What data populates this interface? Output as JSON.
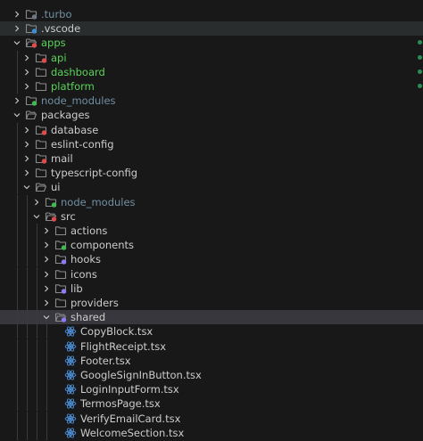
{
  "colors": {
    "background": "#181818",
    "row_highlight": "#2a2d2e",
    "row_selected": "#37373d",
    "text_default": "#cccccc",
    "text_ignored": "#6f8fa3",
    "text_added": "#5ad25a",
    "folder_stroke": "#8a8a8a",
    "tsx_icon": "#4d8fd8",
    "chevron": "#c5c5c5",
    "guide": "#3b3b3b",
    "dot_added": "#2e8b57"
  },
  "explorer": {
    "items": [
      {
        "label": ".turbo",
        "depth": 0,
        "type": "folder",
        "expanded": false,
        "color": "ignored",
        "badge": "#6e7681"
      },
      {
        "label": ".vscode",
        "depth": 0,
        "type": "folder",
        "expanded": false,
        "color": "default",
        "badge": "#3c8fd6",
        "highlight": true
      },
      {
        "label": "apps",
        "depth": 0,
        "type": "folder",
        "expanded": true,
        "color": "added",
        "badge": "#e04a4a",
        "dot": true
      },
      {
        "label": "api",
        "depth": 1,
        "type": "folder",
        "expanded": false,
        "color": "added",
        "badge": "#e04a4a",
        "dot": true
      },
      {
        "label": "dashboard",
        "depth": 1,
        "type": "folder",
        "expanded": false,
        "color": "added",
        "dot": true
      },
      {
        "label": "platform",
        "depth": 1,
        "type": "folder",
        "expanded": false,
        "color": "added",
        "dot": true
      },
      {
        "label": "node_modules",
        "depth": 0,
        "type": "folder",
        "expanded": false,
        "color": "ignored",
        "badge": "#3fb950"
      },
      {
        "label": "packages",
        "depth": 0,
        "type": "folder",
        "expanded": true,
        "color": "default"
      },
      {
        "label": "database",
        "depth": 1,
        "type": "folder",
        "expanded": false,
        "color": "default",
        "badge": "#e04a4a"
      },
      {
        "label": "eslint-config",
        "depth": 1,
        "type": "folder",
        "expanded": false,
        "color": "default"
      },
      {
        "label": "mail",
        "depth": 1,
        "type": "folder",
        "expanded": false,
        "color": "default",
        "badge": "#e04a4a"
      },
      {
        "label": "typescript-config",
        "depth": 1,
        "type": "folder",
        "expanded": false,
        "color": "default"
      },
      {
        "label": "ui",
        "depth": 1,
        "type": "folder",
        "expanded": true,
        "color": "default"
      },
      {
        "label": "node_modules",
        "depth": 2,
        "type": "folder",
        "expanded": false,
        "color": "ignored",
        "badge": "#3fb950"
      },
      {
        "label": "src",
        "depth": 2,
        "type": "folder",
        "expanded": true,
        "color": "default",
        "badge": "#e04a4a"
      },
      {
        "label": "actions",
        "depth": 3,
        "type": "folder",
        "expanded": false,
        "color": "default"
      },
      {
        "label": "components",
        "depth": 3,
        "type": "folder",
        "expanded": false,
        "color": "default",
        "badge": "#3fb950"
      },
      {
        "label": "hooks",
        "depth": 3,
        "type": "folder",
        "expanded": false,
        "color": "default",
        "badge": "#8b7cf6"
      },
      {
        "label": "icons",
        "depth": 3,
        "type": "folder",
        "expanded": false,
        "color": "default"
      },
      {
        "label": "lib",
        "depth": 3,
        "type": "folder",
        "expanded": false,
        "color": "default",
        "badge": "#8b7cf6"
      },
      {
        "label": "providers",
        "depth": 3,
        "type": "folder",
        "expanded": false,
        "color": "default"
      },
      {
        "label": "shared",
        "depth": 3,
        "type": "folder",
        "expanded": true,
        "color": "default",
        "badge": "#8b7cf6",
        "selected": true
      },
      {
        "label": "CopyBlock.tsx",
        "depth": 4,
        "type": "file",
        "color": "default"
      },
      {
        "label": "FlightReceipt.tsx",
        "depth": 4,
        "type": "file",
        "color": "default"
      },
      {
        "label": "Footer.tsx",
        "depth": 4,
        "type": "file",
        "color": "default"
      },
      {
        "label": "GoogleSignInButton.tsx",
        "depth": 4,
        "type": "file",
        "color": "default"
      },
      {
        "label": "LoginInputForm.tsx",
        "depth": 4,
        "type": "file",
        "color": "default"
      },
      {
        "label": "TermosPage.tsx",
        "depth": 4,
        "type": "file",
        "color": "default"
      },
      {
        "label": "VerifyEmailCard.tsx",
        "depth": 4,
        "type": "file",
        "color": "default"
      },
      {
        "label": "WelcomeSection.tsx",
        "depth": 4,
        "type": "file",
        "color": "default"
      }
    ]
  }
}
